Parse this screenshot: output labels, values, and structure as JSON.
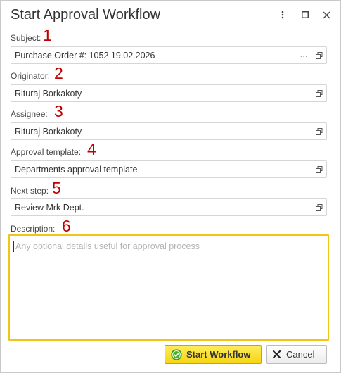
{
  "window": {
    "title": "Start Approval Workflow"
  },
  "fields": {
    "subject": {
      "label": "Subject:",
      "marker": "1",
      "value": "Purchase Order #: 1052 19.02.2026",
      "more_label": "..."
    },
    "originator": {
      "label": "Originator:",
      "marker": "2",
      "value": "Rituraj Borkakoty"
    },
    "assignee": {
      "label": "Assignee:",
      "marker": "3",
      "value": "Rituraj Borkakoty"
    },
    "approval_template": {
      "label": "Approval template:",
      "marker": "4",
      "value": "Departments approval template"
    },
    "next_step": {
      "label": "Next step:",
      "marker": "5",
      "value": "Review Mrk Dept."
    },
    "description": {
      "label": "Description:",
      "marker": "6",
      "value": "",
      "placeholder": "Any optional details useful for approval process"
    }
  },
  "buttons": {
    "start": "Start Workflow",
    "cancel": "Cancel"
  },
  "icons": {
    "menu": "more-vertical-icon",
    "maximize": "maximize-icon",
    "close": "close-icon",
    "open": "open-form-icon",
    "start": "check-circle-icon",
    "cancel": "x-icon"
  },
  "colors": {
    "marker": "#c00000",
    "focus_border": "#f0c419",
    "primary_button": "#f5d514"
  }
}
